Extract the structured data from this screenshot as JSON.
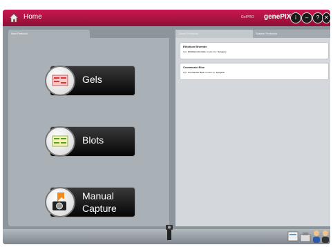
{
  "header": {
    "home_label": "Home",
    "product": "GelPRO",
    "brand": "genePIX"
  },
  "controls": [
    {
      "name": "info-icon",
      "glyph": "i"
    },
    {
      "name": "minimize-icon",
      "glyph": "–"
    },
    {
      "name": "help-icon",
      "glyph": "?"
    },
    {
      "name": "close-icon",
      "glyph": "✕"
    }
  ],
  "left_panel": {
    "tab_label": "New Protocol",
    "buttons": {
      "gels": "Gels",
      "blots": "Blots",
      "manual_line1": "Manual",
      "manual_line2": "Capture"
    }
  },
  "right_panel": {
    "tabs": [
      "Saved Protocols",
      "System Protocols"
    ],
    "protocols": [
      {
        "title": "Ethidium Bromide",
        "type_label": "Dye:",
        "type_value": "Ethidium Bromide",
        "created_label": "Created by:",
        "created_value": "Syngene"
      },
      {
        "title": "Coomassie Blue",
        "type_label": "Dye:",
        "type_value": "Coomassie Blue",
        "created_label": "Created by:",
        "created_value": "Syngene"
      }
    ]
  },
  "colors": {
    "titlebar": "#b0123f",
    "panel": "#a9b0b6",
    "button": "#111111"
  }
}
